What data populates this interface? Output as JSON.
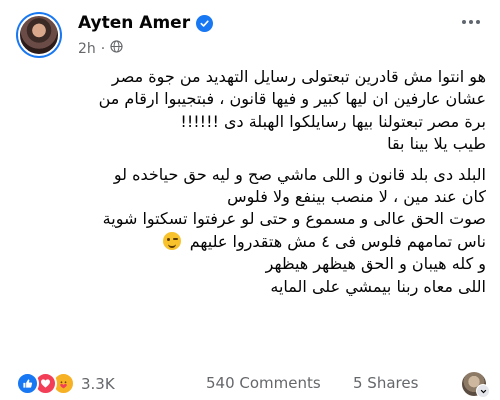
{
  "post": {
    "author": "Ayten Amer",
    "time": "2h",
    "lines": [
      "هو انتوا مش قادرين  تبعتولى رسايل التهديد من جوة مصر",
      "عشان عارفين ان ليها كبير و فيها قانون ، فبتجيبوا ارقام من",
      "برة مصر تبعتولنا بيها رسايلكوا الهبلة دى !!!!!!",
      "طيب يلا بينا بقا",
      "البلد دى بلد قانون و اللى ماشي صح و ليه حق حياخده لو",
      "كان عند مين ، لا منصب بينفع ولا فلوس",
      "صوت الحق عالى و مسموع و حتى لو عرفتوا تسكتوا شوية",
      "ناس تمامهم فلوس  فى ٤  مش هتقدروا عليهم",
      "و كله هيبان و الحق هيظهر هيظهر",
      "اللى معاه ربنا بيمشي على المايه"
    ]
  },
  "footer": {
    "reactions_count": "3.3K",
    "comments": "540 Comments",
    "shares": "5 Shares"
  },
  "icons": {
    "verified": "verified-badge-icon",
    "privacy": "globe-icon",
    "more": "more-options-icon",
    "wink": "wink-emoji-icon",
    "reactions": [
      "like-icon",
      "love-icon",
      "care-icon"
    ]
  },
  "colors": {
    "accent": "#1877f2",
    "secondary_text": "#65676b",
    "like": "#1877f2",
    "love": "#f33e58",
    "care": "#f7b125"
  }
}
